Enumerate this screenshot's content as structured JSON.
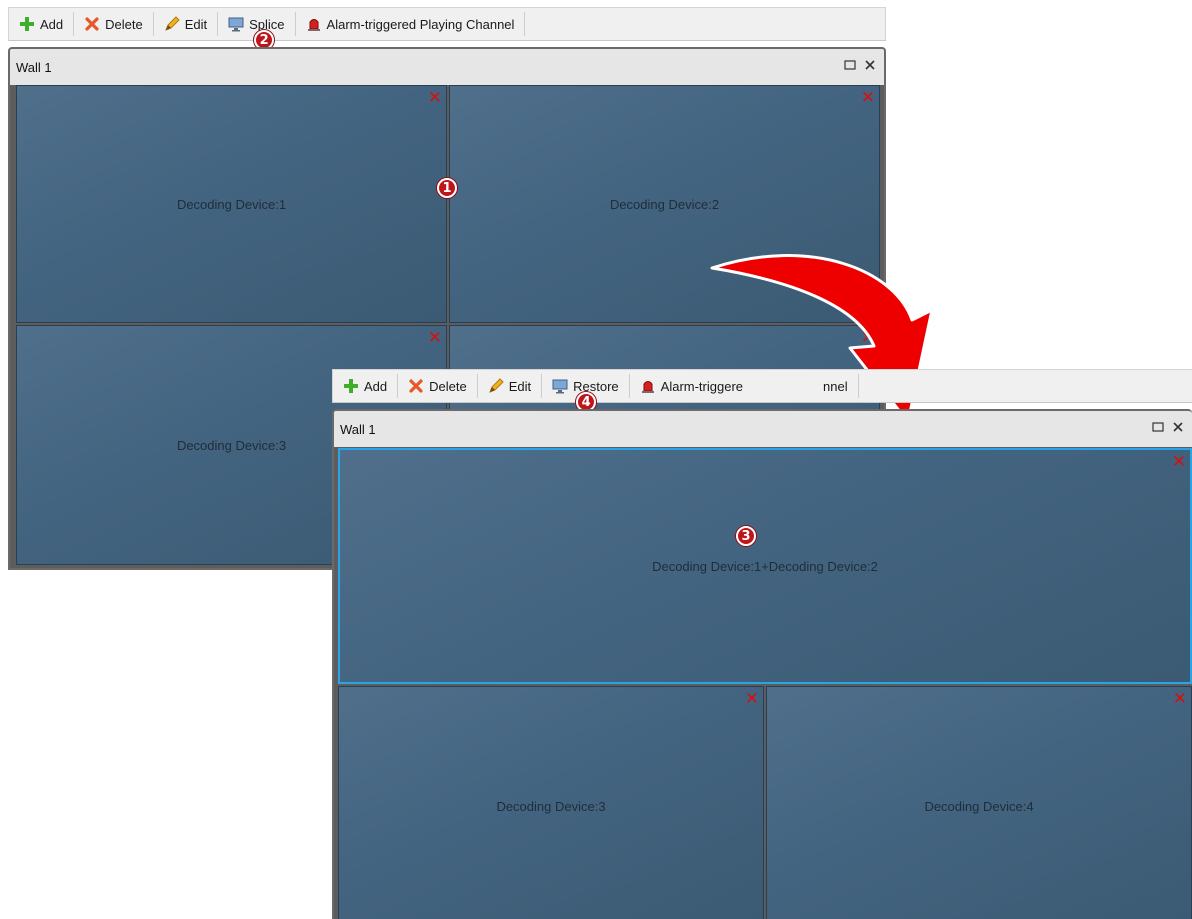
{
  "panel_before": {
    "toolbar": {
      "add": "Add",
      "delete": "Delete",
      "edit": "Edit",
      "splice": "Splice",
      "alarm": "Alarm-triggered Playing Channel"
    },
    "window": {
      "title": "Wall 1"
    },
    "cells": [
      {
        "label": "Decoding Device:1"
      },
      {
        "label": "Decoding Device:2"
      },
      {
        "label": "Decoding Device:3"
      },
      {
        "label": ""
      }
    ],
    "badges": [
      "1",
      "2"
    ]
  },
  "panel_after": {
    "toolbar": {
      "add": "Add",
      "delete": "Delete",
      "edit": "Edit",
      "restore": "Restore",
      "alarm_visible_start": "Alarm-triggere",
      "alarm_visible_end": "nnel"
    },
    "window": {
      "title": "Wall 1"
    },
    "cells": [
      {
        "label": "Decoding Device:1+Decoding Device:2"
      },
      {
        "label": "Decoding Device:3"
      },
      {
        "label": "Decoding Device:4"
      }
    ],
    "badges": [
      "3",
      "4"
    ]
  },
  "icons": {
    "add": "plus-icon",
    "delete": "x-icon",
    "edit": "pencil-icon",
    "splice": "monitor-icon",
    "alarm": "alarm-light-icon",
    "maximize": "maximize-icon",
    "close": "close-icon",
    "cell_close": "cell-close-icon",
    "arrow": "curved-arrow-icon"
  },
  "colors": {
    "cell_fill": "#46677f",
    "close_red": "#d41010",
    "badge_red": "#c0141b",
    "selected_border": "#2aa4e8",
    "arrow_red": "#ee0000"
  }
}
